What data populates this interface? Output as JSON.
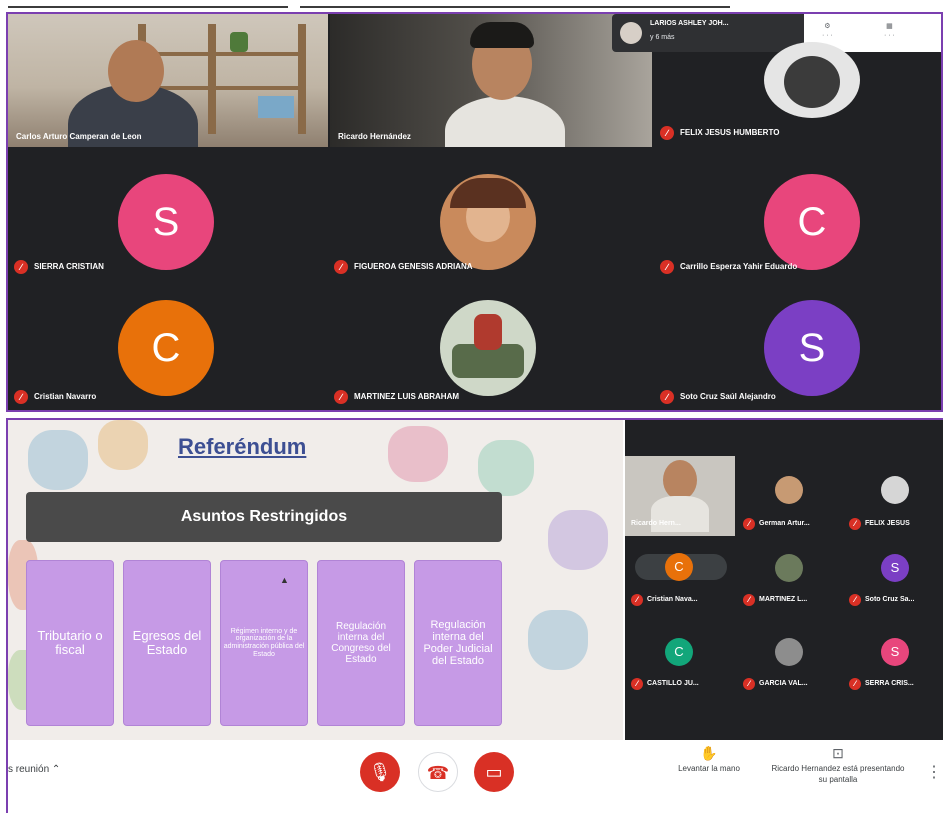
{
  "panel1": {
    "video_tiles": [
      {
        "name": "Carlos Arturo Camperan de Leon"
      },
      {
        "name": "Ricardo Hernández"
      }
    ],
    "raised_hand": {
      "name": "LARIOS ASHLEY JOH...",
      "sub": "y 6 más"
    },
    "top_icons": [
      "gear-icon",
      "layout-icon"
    ],
    "participants": [
      {
        "name": "FELIX JESUS HUMBERTO",
        "avatar": "photo"
      },
      {
        "name": "SIERRA CRISTIAN",
        "avatar": "S",
        "color": "#e8467c"
      },
      {
        "name": "FIGUEROA GENESIS ADRIANA",
        "avatar": "photo"
      },
      {
        "name": "Carrillo Esperza Yahir Eduardo",
        "avatar": "C",
        "color": "#e8467c"
      },
      {
        "name": "Cristian Navarro",
        "avatar": "C",
        "color": "#e8710a"
      },
      {
        "name": "MARTINEZ LUIS ABRAHAM",
        "avatar": "photo"
      },
      {
        "name": "Soto Cruz Saúl Alejandro",
        "avatar": "S",
        "color": "#7b3fc4"
      }
    ]
  },
  "slide": {
    "title": "Referéndum",
    "header": "Asuntos Restringidos",
    "boxes": [
      "Tributario o fiscal",
      "Egresos del Estado",
      "Régimen interno y de organización de la administración pública del Estado",
      "Regulación interna del Congreso del Estado",
      "Regulación interna del Poder Judicial del Estado"
    ]
  },
  "side_participants": [
    {
      "name": "Ricardo Hern...",
      "avatar": "video"
    },
    {
      "name": "German Artur...",
      "avatar": "photo"
    },
    {
      "name": "FELIX JESUS",
      "avatar": "photo"
    },
    {
      "name": "Cristian Nava...",
      "avatar": "C",
      "color": "#e8710a"
    },
    {
      "name": "MARTINEZ L...",
      "avatar": "photo"
    },
    {
      "name": "Soto Cruz Sa...",
      "avatar": "S",
      "color": "#7b3fc4"
    },
    {
      "name": "CASTILLO JU...",
      "avatar": "C",
      "color": "#12a67a"
    },
    {
      "name": "GARCIA VAL...",
      "avatar": "photo"
    },
    {
      "name": "SERRA CRIS...",
      "avatar": "S",
      "color": "#e8467c"
    }
  ],
  "controls": {
    "meeting_details": "s reunión",
    "raise_hand_label": "Levantar la mano",
    "presenting_label": "Ricardo Hernandez está presentando su pantalla"
  },
  "colors": {
    "accent_border": "#7b3fb0",
    "mute_red": "#d93025",
    "meet_dark": "#202124",
    "slide_box": "#c69ae6"
  }
}
